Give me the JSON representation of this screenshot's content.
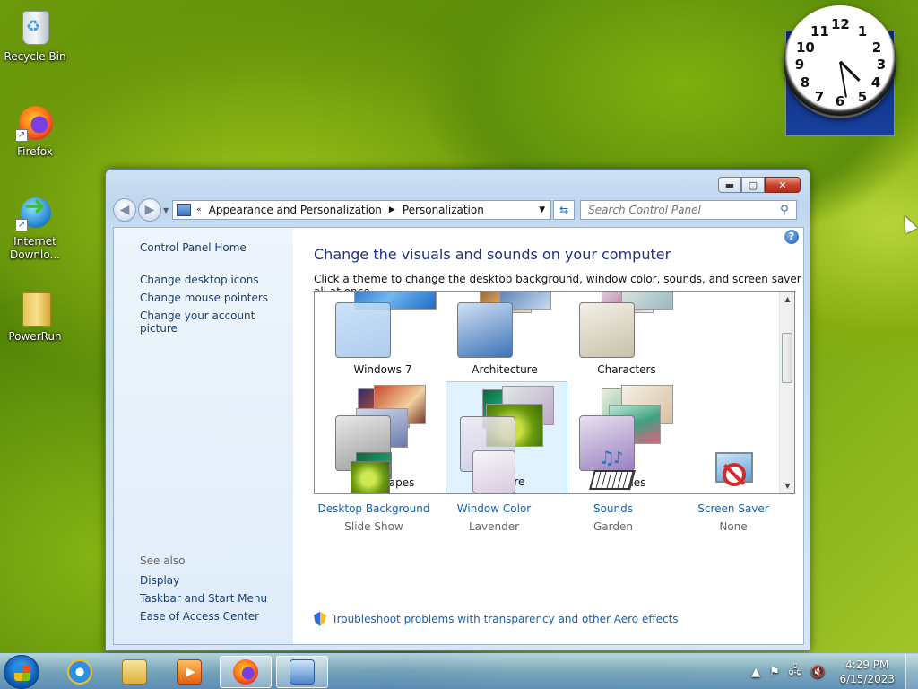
{
  "desktop": {
    "icons": [
      {
        "label": "Recycle Bin"
      },
      {
        "label": "Firefox"
      },
      {
        "label": "Internet Downlo..."
      },
      {
        "label": "PowerRun"
      }
    ]
  },
  "window": {
    "breadcrumb": [
      "Appearance and Personalization",
      "Personalization"
    ],
    "search_placeholder": "Search Control Panel",
    "left_pane": {
      "home": "Control Panel Home",
      "links": [
        "Change desktop icons",
        "Change mouse pointers",
        "Change your account picture"
      ],
      "see_also_title": "See also",
      "see_also": [
        "Display",
        "Taskbar and Start Menu",
        "Ease of Access Center"
      ]
    },
    "main": {
      "heading": "Change the visuals and sounds on your computer",
      "description": "Click a theme to change the desktop background, window color, sounds, and screen saver all at once.",
      "themes": [
        "Windows 7",
        "Architecture",
        "Characters",
        "Landscapes",
        "Nature",
        "Scenes"
      ],
      "selected_theme": "Nature",
      "bottom": [
        {
          "label": "Desktop Background",
          "value": "Slide Show"
        },
        {
          "label": "Window Color",
          "value": "Lavender"
        },
        {
          "label": "Sounds",
          "value": "Garden"
        },
        {
          "label": "Screen Saver",
          "value": "None"
        }
      ],
      "troubleshoot": "Troubleshoot problems with transparency and other Aero effects"
    }
  },
  "taskbar": {
    "time": "4:29 PM",
    "date": "6/15/2023"
  },
  "colors": {
    "heading": "#1e3287",
    "link": "#1a5fa8",
    "selection": "#cce8ff"
  }
}
